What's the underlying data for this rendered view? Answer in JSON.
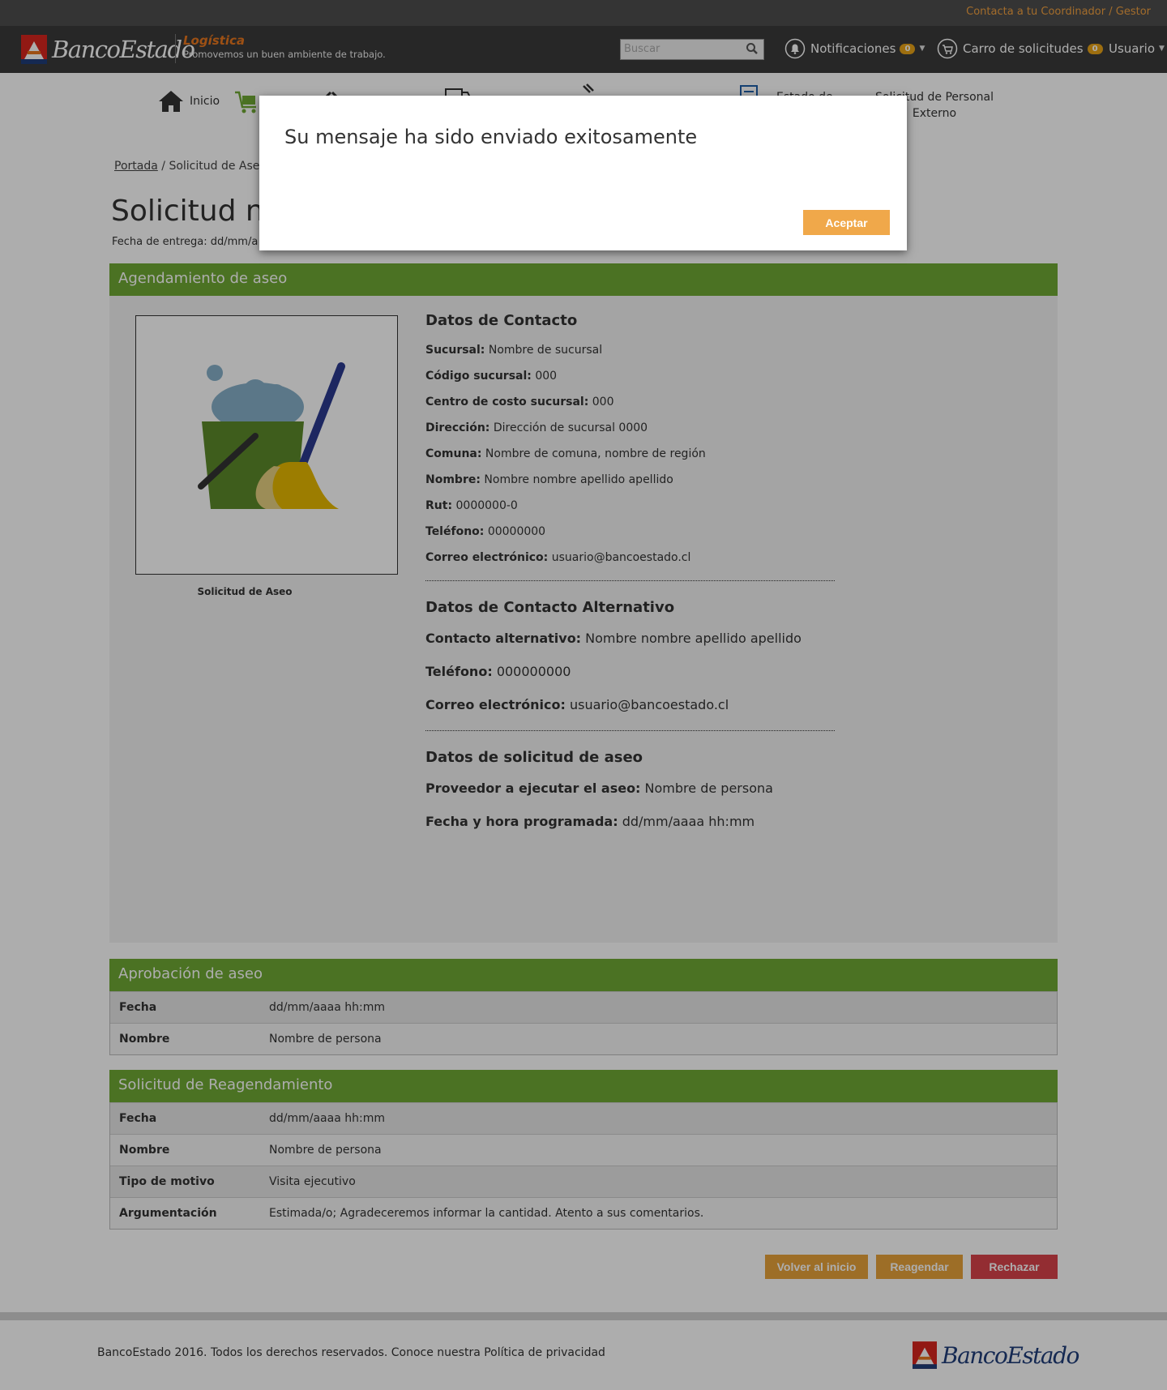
{
  "header": {
    "contact_link": "Contacta a tu Coordinador / Gestor",
    "brand": "BancoEstado",
    "app_name": "Logística",
    "tagline": "Promovemos un buen ambiente de trabajo.",
    "search_placeholder": "Buscar",
    "notifications_label": "Notificaciones",
    "notifications_count": "0",
    "cart_label": "Carro de solicitudes",
    "cart_count": "0",
    "user_label": "Usuario"
  },
  "nav": {
    "items": [
      {
        "label": "Inicio",
        "icon": "home-icon"
      },
      {
        "label": "",
        "icon": "cart-icon"
      },
      {
        "label": "",
        "icon": "tools-icon"
      },
      {
        "label": "",
        "icon": "truck-icon"
      },
      {
        "label": "",
        "icon": "hammer-icon"
      },
      {
        "label": "Estado de",
        "icon": "status-icon"
      },
      {
        "label": "Solicitud de Personal Externo",
        "icon": ""
      }
    ]
  },
  "page": {
    "breadcrumb_home": "Portada",
    "breadcrumb_current": "Solicitud de Aseo",
    "title": "Solicitud nº",
    "delivery_date": "Fecha de entrega: dd/mm/a"
  },
  "agendamiento": {
    "heading": "Agendamiento de aseo",
    "image_caption": "Solicitud de Aseo",
    "contact_heading": "Datos de Contacto",
    "contact": [
      {
        "label": "Sucursal:",
        "value": "Nombre de sucursal"
      },
      {
        "label": "Código sucursal:",
        "value": "000"
      },
      {
        "label": "Centro de costo sucursal:",
        "value": "000"
      },
      {
        "label": "Dirección:",
        "value": "Dirección de sucursal 0000"
      },
      {
        "label": "Comuna:",
        "value": "Nombre de comuna, nombre de región"
      },
      {
        "label": "Nombre:",
        "value": "Nombre nombre apellido apellido"
      },
      {
        "label": "Rut:",
        "value": "0000000-0"
      },
      {
        "label": "Teléfono:",
        "value": "00000000"
      },
      {
        "label": "Correo electrónico:",
        "value": "usuario@bancoestado.cl"
      }
    ],
    "alt_heading": "Datos de Contacto Alternativo",
    "alt_contact": [
      {
        "label": "Contacto alternativo:",
        "value": "Nombre nombre apellido apellido"
      },
      {
        "label": "Teléfono:",
        "value": "000000000"
      },
      {
        "label": "Correo electrónico:",
        "value": "usuario@bancoestado.cl"
      }
    ],
    "request_heading": "Datos de solicitud de aseo",
    "request": [
      {
        "label": "Proveedor a ejecutar el aseo:",
        "value": "Nombre de persona"
      },
      {
        "label": "Fecha y hora programada:",
        "value": "dd/mm/aaaa hh:mm"
      }
    ]
  },
  "aprobacion": {
    "heading": "Aprobación de aseo",
    "rows": [
      {
        "label": "Fecha",
        "value": "dd/mm/aaaa hh:mm"
      },
      {
        "label": "Nombre",
        "value": "Nombre de persona"
      }
    ]
  },
  "reagendamiento": {
    "heading": "Solicitud de Reagendamiento",
    "rows": [
      {
        "label": "Fecha",
        "value": "dd/mm/aaaa hh:mm"
      },
      {
        "label": "Nombre",
        "value": "Nombre de persona"
      },
      {
        "label": "Tipo de motivo",
        "value": "Visita ejecutivo"
      },
      {
        "label": "Argumentación",
        "value": "Estimada/o;  Agradeceremos informar la cantidad. Atento a sus comentarios."
      }
    ]
  },
  "actions": {
    "back": "Volver al inicio",
    "reschedule": "Reagendar",
    "reject": "Rechazar"
  },
  "footer": {
    "text": "BancoEstado 2016. Todos los derechos reservados. Conoce nuestra Política de privacidad",
    "brand": "BancoEstado"
  },
  "modal": {
    "message": "Su mensaje ha sido enviado exitosamente",
    "accept": "Aceptar"
  },
  "colors": {
    "accent_green": "#6fa834",
    "accent_orange": "#f0a84a",
    "danger_red": "#d9534f",
    "header_dark": "#3a3a3a"
  }
}
